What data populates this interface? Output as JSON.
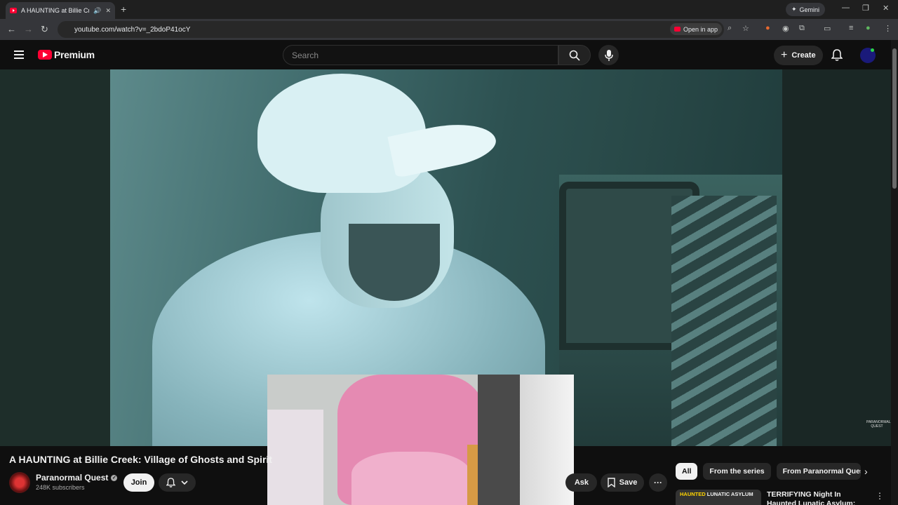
{
  "browser": {
    "tab_title": "A HAUNTING at Billie Creek",
    "url": "youtube.com/watch?v=_2bdoP41ocY",
    "open_in_app": "Open in app",
    "gemini_label": "Gemini"
  },
  "youtube": {
    "logo_text": "Premium",
    "search_placeholder": "Search",
    "create_label": "Create"
  },
  "video": {
    "title": "A HAUNTING at Billie Creek: Village of Ghosts and Spirit",
    "watermark": "PARANORMAL QUEST"
  },
  "channel": {
    "name": "Paranormal Quest",
    "subscribers": "248K subscribers",
    "join_label": "Join"
  },
  "actions": {
    "ask_label": "Ask",
    "save_label": "Save"
  },
  "chips": [
    "All",
    "From the series",
    "From Paranormal Quest"
  ],
  "recommendation": {
    "thumb_text_1": "HAUNTED",
    "thumb_text_2": "LUNATIC ASYLUM",
    "title": "TERRIFYING Night In Haunted Lunatic Asylum: Paranormal"
  }
}
